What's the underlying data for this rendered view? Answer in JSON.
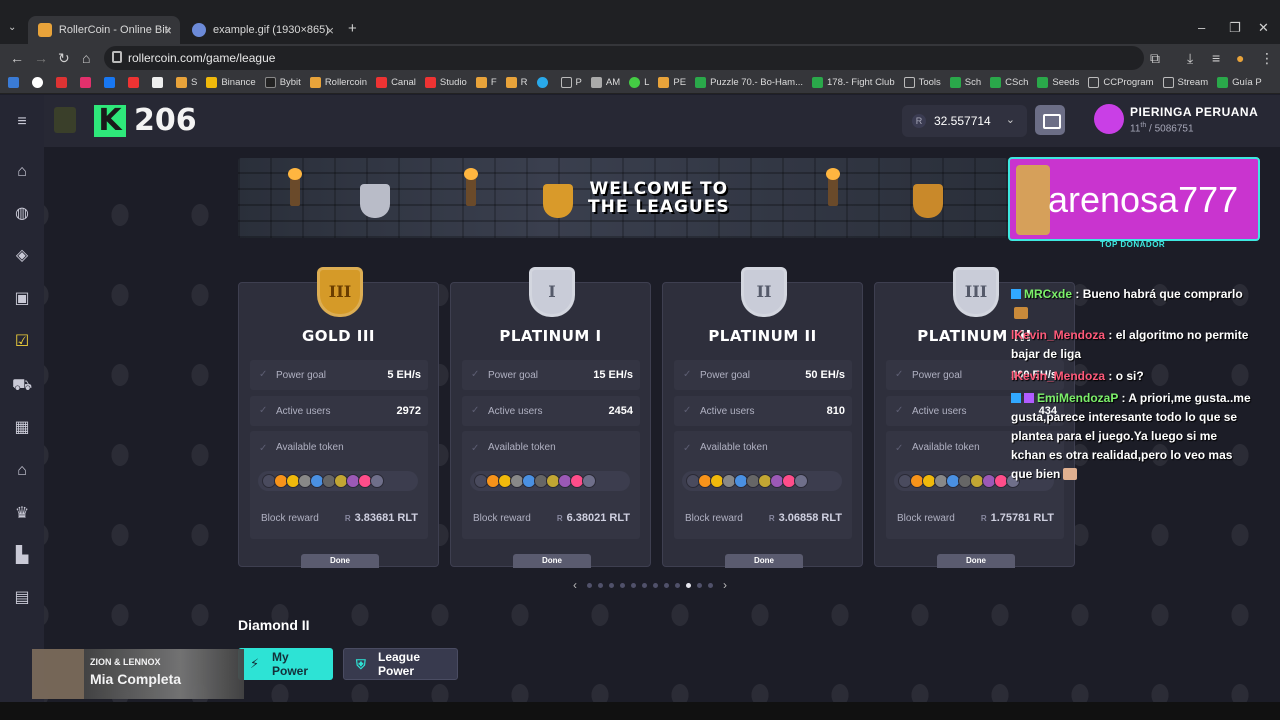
{
  "browser": {
    "tabs": [
      {
        "title": "RollerCoin - Online Bitcoin Mini",
        "active": true
      },
      {
        "title": "example.gif (1930×865)",
        "active": false
      }
    ],
    "new_tab": "+",
    "url": "rollercoin.com/game/league",
    "bookmarks": [
      "S",
      "Binance",
      "Bybit",
      "Rollercoin",
      "Canal",
      "Studio",
      "F",
      "R",
      "P",
      "AM",
      "L",
      "PE",
      "Puzzle 70.- Bo-Ham...",
      "178.- Fight Club",
      "Tools",
      "Sch",
      "CSch",
      "Seeds",
      "CCProgram",
      "Stream",
      "Guía P"
    ]
  },
  "header": {
    "level_letter": "K",
    "level": "206",
    "balance": "32.557714",
    "balance_currency": "R",
    "user_name": "PIERINGA PERUANA",
    "user_rank_pos": "11",
    "user_rank_sup": "th",
    "user_rank_total": "/ 5086751"
  },
  "banner": {
    "line1": "WELCOME TO",
    "line2": "THE LEAGUES"
  },
  "donor": {
    "name": "arenosa777",
    "label": "TOP DONADOR"
  },
  "labels": {
    "power_goal": "Power goal",
    "active_users": "Active users",
    "available_token": "Available token",
    "block_reward": "Block reward",
    "done": "Done",
    "reward_unit_prefix": "R"
  },
  "leagues": [
    {
      "name": "GOLD III",
      "badge": "III",
      "power_goal": "5 EH/s",
      "active_users": "2972",
      "block_reward": "3.83681 RLT",
      "color": "#e9b93a"
    },
    {
      "name": "PLATINUM I",
      "badge": "I",
      "power_goal": "15 EH/s",
      "active_users": "2454",
      "block_reward": "6.38021 RLT",
      "color": "#c7cbd8"
    },
    {
      "name": "PLATINUM II",
      "badge": "II",
      "power_goal": "50 EH/s",
      "active_users": "810",
      "block_reward": "3.06858 RLT",
      "color": "#c7cbd8"
    },
    {
      "name": "PLATINUM III",
      "badge": "III",
      "power_goal": "100 EH/s",
      "active_users": "434",
      "block_reward": "1.75781 RLT",
      "color": "#c7cbd8"
    }
  ],
  "pager": {
    "prev": "‹",
    "next": "›",
    "active_index": 10,
    "count": 12
  },
  "section": {
    "current_league": "Diamond II",
    "my_power": "My Power",
    "league_power": "League Power"
  },
  "music": {
    "artist": "ZION & LENNOX",
    "song": "Mia Completa"
  },
  "chat": [
    {
      "user": "MRCxde",
      "text": ": Bueno habrá que comprarlo"
    },
    {
      "user": "lKevin_Mendoza",
      "text": ": el algoritmo no permite bajar de liga"
    },
    {
      "user": "lKevin_Mendoza",
      "text": ": o si?"
    },
    {
      "user": "EmiMendozaP",
      "text": ": A priori,me gusta..me gusta,parece interesante todo lo que se plantea para el juego.Ya luego si me kchan es otra realidad,pero lo veo mas que bien"
    }
  ]
}
